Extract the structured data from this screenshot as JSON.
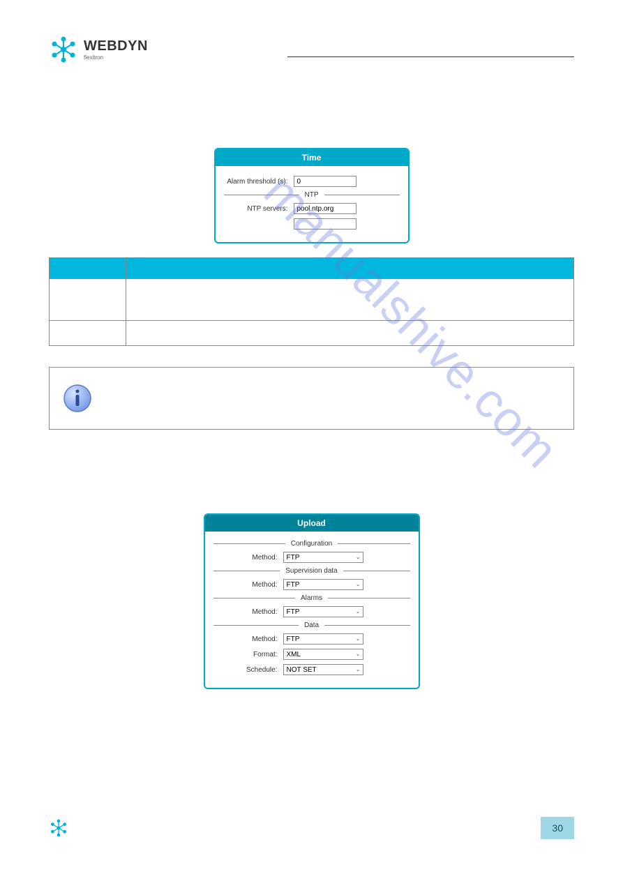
{
  "header": {
    "brand": "WEBDYN",
    "sub": "flexitron"
  },
  "timePanel": {
    "title": "Time",
    "alarmLabel": "Alarm threshold (s):",
    "alarmValue": "0",
    "ntpSection": "NTP",
    "ntpLabel": "NTP servers:",
    "ntpValue1": "pool.ntp.org",
    "ntpValue2": ""
  },
  "table": {
    "h1": "",
    "h2": "",
    "r1c1": "",
    "r1c2": "",
    "r2c1": "",
    "r2c2": ""
  },
  "uploadPanel": {
    "title": "Upload",
    "sections": {
      "config": "Configuration",
      "supervision": "Supervision data",
      "alarms": "Alarms",
      "data": "Data"
    },
    "methodLabel": "Method:",
    "formatLabel": "Format:",
    "scheduleLabel": "Schedule:",
    "methodValue": "FTP",
    "formatValue": "XML",
    "scheduleValue": "NOT SET"
  },
  "watermark": "manualshive.com",
  "pageNumber": "30"
}
